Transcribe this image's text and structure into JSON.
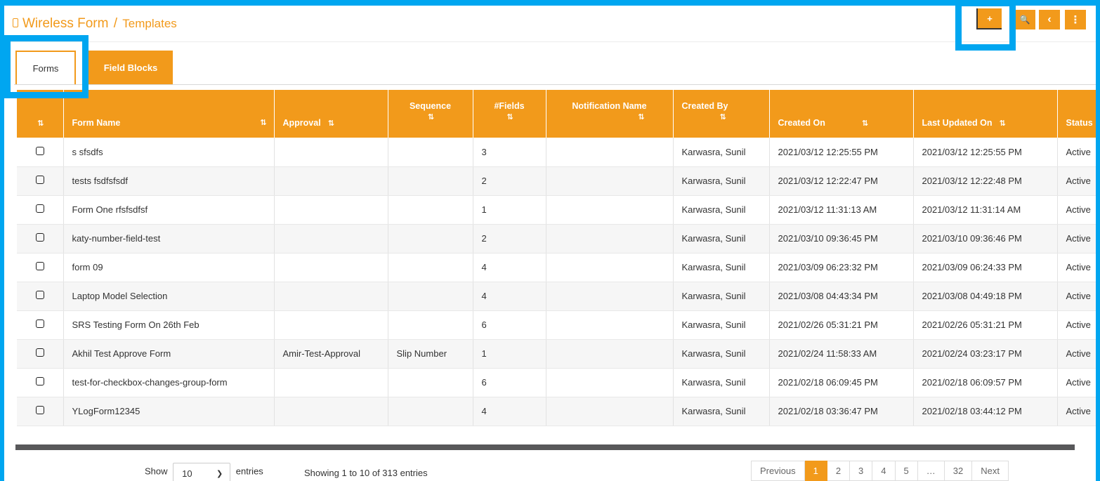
{
  "header": {
    "app_title": "Wireless Form",
    "separator": "/",
    "section": "Templates",
    "add_label": "+",
    "search_label": "🔍",
    "back_label": "‹",
    "more_label": "⋮"
  },
  "tabs": [
    {
      "label": "Forms"
    },
    {
      "label": "Field Blocks"
    }
  ],
  "table": {
    "sort_glyph": "⇅",
    "columns": [
      {
        "label": "Form Name"
      },
      {
        "label": "Approval"
      },
      {
        "label": "Sequence"
      },
      {
        "label": "#Fields"
      },
      {
        "label": "Notification Name"
      },
      {
        "label": "Created By"
      },
      {
        "label": "Created On"
      },
      {
        "label": "Last Updated On"
      },
      {
        "label": "Status"
      }
    ],
    "rows": [
      {
        "name": "s sfsdfs",
        "approval": "",
        "sequence": "",
        "fields": "3",
        "notification": "",
        "created_by": "Karwasra, Sunil",
        "created_on": "2021/03/12 12:25:55 PM",
        "updated_on": "2021/03/12 12:25:55 PM",
        "status": "Active"
      },
      {
        "name": "tests fsdfsfsdf",
        "approval": "",
        "sequence": "",
        "fields": "2",
        "notification": "",
        "created_by": "Karwasra, Sunil",
        "created_on": "2021/03/12 12:22:47 PM",
        "updated_on": "2021/03/12 12:22:48 PM",
        "status": "Active"
      },
      {
        "name": "Form One rfsfsdfsf",
        "approval": "",
        "sequence": "",
        "fields": "1",
        "notification": "",
        "created_by": "Karwasra, Sunil",
        "created_on": "2021/03/12 11:31:13 AM",
        "updated_on": "2021/03/12 11:31:14 AM",
        "status": "Active"
      },
      {
        "name": "katy-number-field-test",
        "approval": "",
        "sequence": "",
        "fields": "2",
        "notification": "",
        "created_by": "Karwasra, Sunil",
        "created_on": "2021/03/10 09:36:45 PM",
        "updated_on": "2021/03/10 09:36:46 PM",
        "status": "Active"
      },
      {
        "name": "form 09",
        "approval": "",
        "sequence": "",
        "fields": "4",
        "notification": "",
        "created_by": "Karwasra, Sunil",
        "created_on": "2021/03/09 06:23:32 PM",
        "updated_on": "2021/03/09 06:24:33 PM",
        "status": "Active"
      },
      {
        "name": "Laptop Model Selection",
        "approval": "",
        "sequence": "",
        "fields": "4",
        "notification": "",
        "created_by": "Karwasra, Sunil",
        "created_on": "2021/03/08 04:43:34 PM",
        "updated_on": "2021/03/08 04:49:18 PM",
        "status": "Active"
      },
      {
        "name": "SRS Testing Form On 26th Feb",
        "approval": "",
        "sequence": "",
        "fields": "6",
        "notification": "",
        "created_by": "Karwasra, Sunil",
        "created_on": "2021/02/26 05:31:21 PM",
        "updated_on": "2021/02/26 05:31:21 PM",
        "status": "Active"
      },
      {
        "name": "Akhil Test Approve Form",
        "approval": "Amir-Test-Approval",
        "sequence": "Slip Number",
        "fields": "1",
        "notification": "",
        "created_by": "Karwasra, Sunil",
        "created_on": "2021/02/24 11:58:33 AM",
        "updated_on": "2021/02/24 03:23:17 PM",
        "status": "Active"
      },
      {
        "name": "test-for-checkbox-changes-group-form",
        "approval": "",
        "sequence": "",
        "fields": "6",
        "notification": "",
        "created_by": "Karwasra, Sunil",
        "created_on": "2021/02/18 06:09:45 PM",
        "updated_on": "2021/02/18 06:09:57 PM",
        "status": "Active"
      },
      {
        "name": "YLogForm12345",
        "approval": "",
        "sequence": "",
        "fields": "4",
        "notification": "",
        "created_by": "Karwasra, Sunil",
        "created_on": "2021/02/18 03:36:47 PM",
        "updated_on": "2021/02/18 03:44:12 PM",
        "status": "Active"
      }
    ]
  },
  "footer": {
    "show_label": "Show",
    "page_size": "10",
    "entries_label": "entries",
    "info": "Showing 1 to 10 of 313 entries",
    "pages": [
      "Previous",
      "1",
      "2",
      "3",
      "4",
      "5",
      "…",
      "32",
      "Next"
    ],
    "active_page": "1"
  },
  "colors": {
    "accent": "#f29a1b",
    "highlight": "#00a6f0"
  }
}
